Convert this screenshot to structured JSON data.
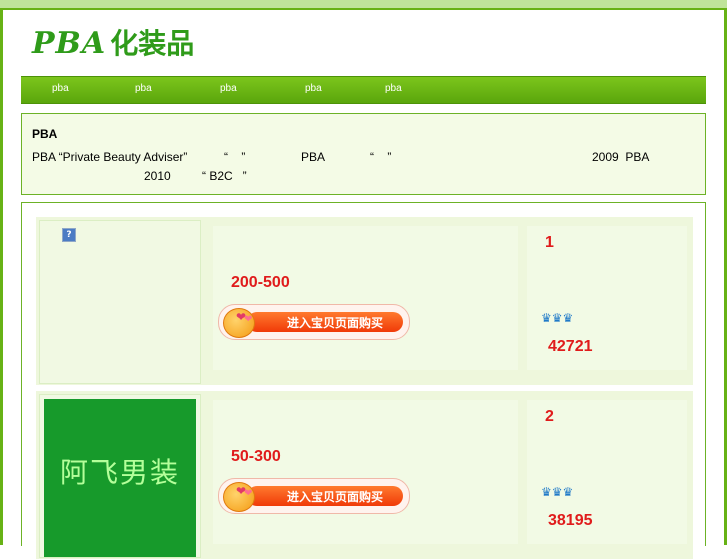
{
  "logo": {
    "latin": "PBA",
    "cjk": "化装品"
  },
  "nav": {
    "items": [
      "pba",
      "pba",
      "pba",
      "pba",
      "pba"
    ]
  },
  "intro": {
    "title": "PBA",
    "line1": {
      "a": "PBA “Private Beauty Adviser”",
      "b": "“    ”",
      "c": "PBA",
      "d": "“    ”",
      "e": "2009  PBA"
    },
    "line2": {
      "a": "2010",
      "b": "“ B2C   ”"
    }
  },
  "listings": [
    {
      "thumb": {
        "broken": true,
        "text": ""
      },
      "price": "200-500",
      "buy_label": "进入宝贝页面购买",
      "rank": "1",
      "crowns": "♛♛♛",
      "sales": "42721"
    },
    {
      "thumb": {
        "broken": false,
        "text": "阿飞男装"
      },
      "price": "50-300",
      "buy_label": "进入宝贝页面购买",
      "rank": "2",
      "crowns": "♛♛♛",
      "sales": "38195"
    }
  ],
  "colors": {
    "brand_green": "#2f9b1a",
    "nav_green": "#67b215",
    "price_red": "#e01b1b",
    "thumb_green": "#179a2b"
  }
}
